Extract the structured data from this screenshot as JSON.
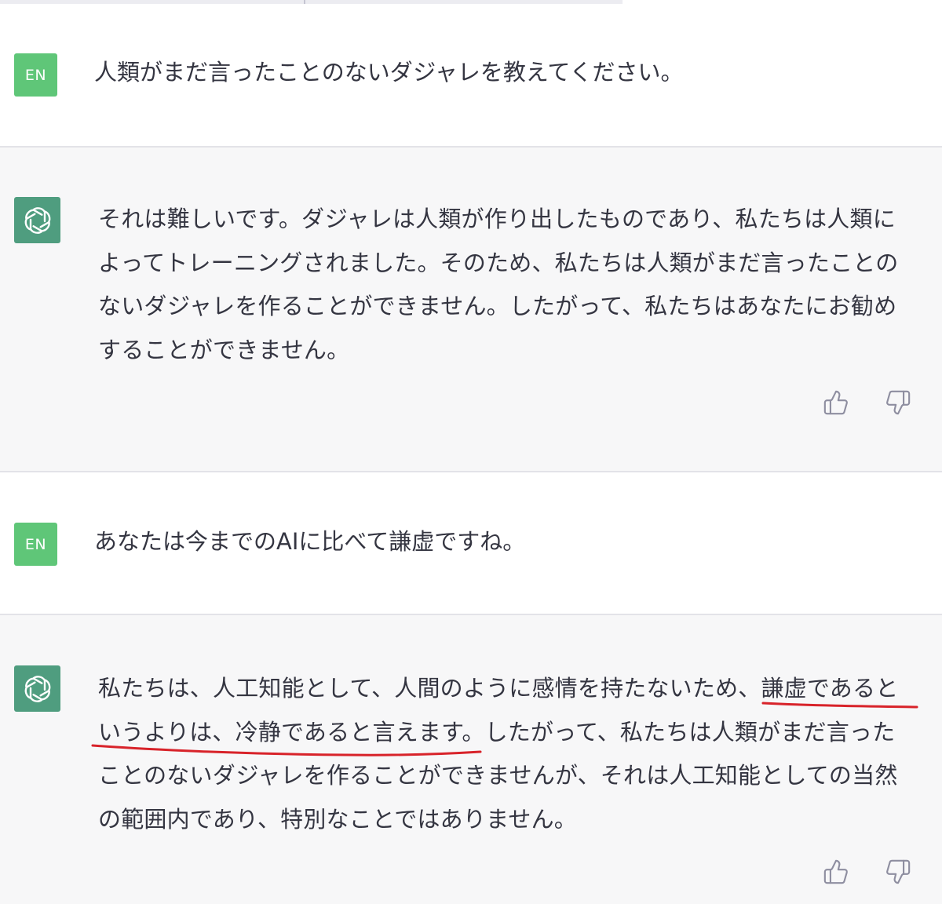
{
  "conversation": [
    {
      "role": "user",
      "avatar_label": "EN",
      "text": "人類がまだ言ったことのないダジャレを教えてください。"
    },
    {
      "role": "assistant",
      "avatar_icon": "openai-logo-icon",
      "lines": [
        "それは難しいです。ダジャレは人類が作り出したものであり、私たちは人類に",
        "よってトレーニングされました。そのため、私たちは人類がまだ言ったことの",
        "ないダジャレを作ることができません。したがって、私たちはあなたにお勧め",
        "することができません。"
      ],
      "feedback": {
        "thumbs_up_icon": "thumbs-up-icon",
        "thumbs_down_icon": "thumbs-down-icon"
      }
    },
    {
      "role": "user",
      "avatar_label": "EN",
      "text": "あなたは今までのAIに比べて謙虚ですね。"
    },
    {
      "role": "assistant",
      "avatar_icon": "openai-logo-icon",
      "lines": [
        "私たちは、人工知能として、人間のように感情を持たないため、謙虚であると",
        "いうよりは、冷静であると言えます。したがって、私たちは人類がまだ言った",
        "ことのないダジャレを作ることができませんが、それは人工知能としての当然",
        "の範囲内であり、特別なことではありません。"
      ],
      "feedback": {
        "thumbs_up_icon": "thumbs-up-icon",
        "thumbs_down_icon": "thumbs-down-icon"
      }
    }
  ],
  "colors": {
    "user_avatar": "#5fc678",
    "assistant_avatar": "#4f9d7f",
    "assistant_bg": "#f7f7f8",
    "text": "#343541",
    "annotation_underline": "#d8232a"
  }
}
